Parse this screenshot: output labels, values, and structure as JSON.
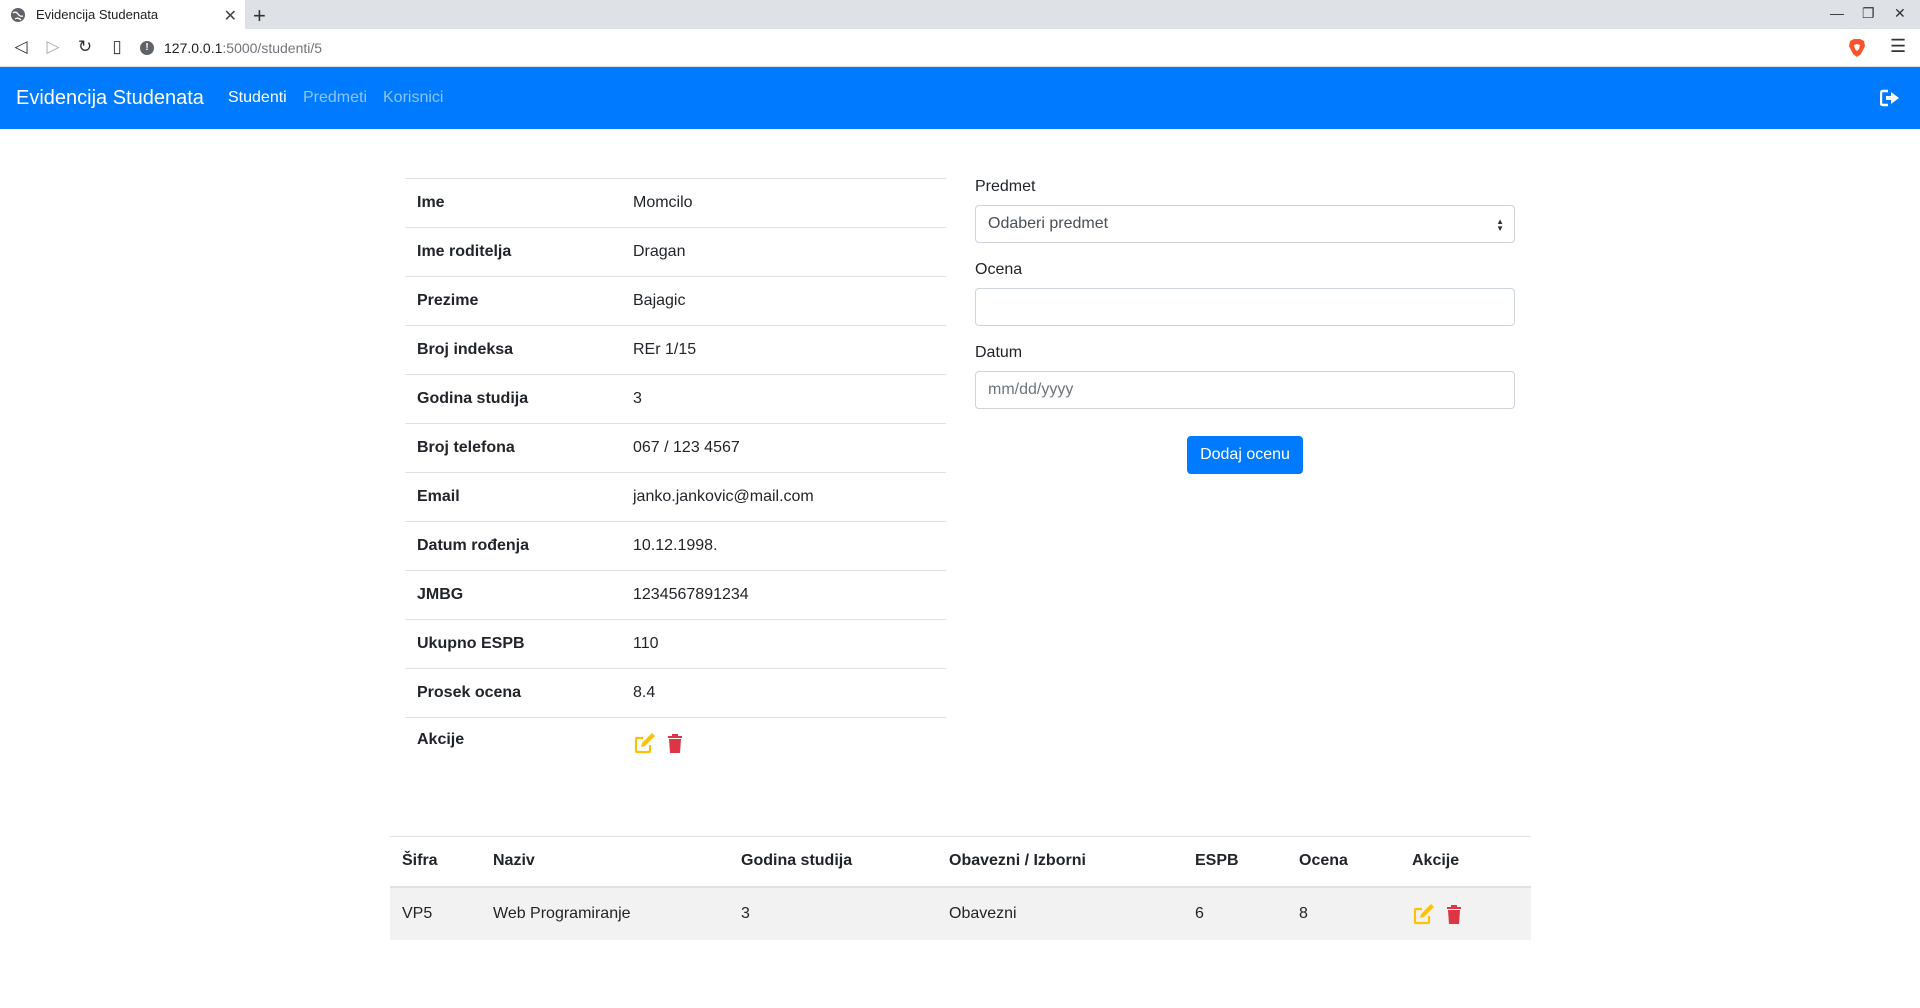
{
  "browser": {
    "tab_title": "Evidencija Studenata",
    "url_host": "127.0.0.1",
    "url_path": ":5000/studenti/5"
  },
  "navbar": {
    "brand": "Evidencija Studenata",
    "links": [
      "Studenti",
      "Predmeti",
      "Korisnici"
    ],
    "active": "Studenti"
  },
  "student": {
    "rows": [
      {
        "label": "Ime",
        "value": "Momcilo"
      },
      {
        "label": "Ime roditelja",
        "value": "Dragan"
      },
      {
        "label": "Prezime",
        "value": "Bajagic"
      },
      {
        "label": "Broj indeksa",
        "value": "REr 1/15"
      },
      {
        "label": "Godina studija",
        "value": "3"
      },
      {
        "label": "Broj telefona",
        "value": "067 / 123 4567"
      },
      {
        "label": "Email",
        "value": "janko.jankovic@mail.com"
      },
      {
        "label": "Datum rođenja",
        "value": "10.12.1998."
      },
      {
        "label": "JMBG",
        "value": "1234567891234"
      },
      {
        "label": "Ukupno ESPB",
        "value": "110"
      },
      {
        "label": "Prosek ocena",
        "value": "8.4"
      }
    ],
    "actions_label": "Akcije"
  },
  "form": {
    "predmet_label": "Predmet",
    "predmet_selected": "Odaberi predmet",
    "ocena_label": "Ocena",
    "ocena_value": "",
    "datum_label": "Datum",
    "datum_placeholder": "mm/dd/yyyy",
    "submit_label": "Dodaj ocenu"
  },
  "grades": {
    "headers": [
      "Šifra",
      "Naziv",
      "Godina studija",
      "Obavezni / Izborni",
      "ESPB",
      "Ocena",
      "Akcije"
    ],
    "rows": [
      {
        "sifra": "VP5",
        "naziv": "Web Programiranje",
        "godina": "3",
        "tip": "Obavezni",
        "espb": "6",
        "ocena": "8"
      }
    ]
  },
  "colors": {
    "primary": "#007bff",
    "edit": "#ffc107",
    "delete": "#dc3545"
  }
}
